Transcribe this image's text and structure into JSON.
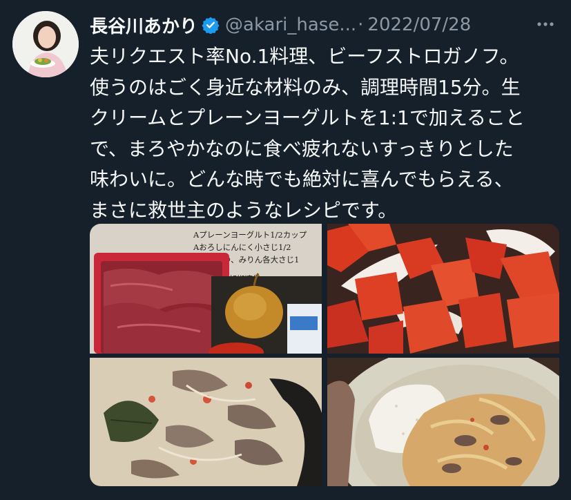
{
  "tweet": {
    "author_name": "長谷川あかり",
    "handle": "@akari_hase...",
    "separator": "·",
    "date": "2022/07/28",
    "verified": true,
    "text_lines": [
      "夫リクエスト率No.1料理、ビーフストロガノフ。",
      "使うのはごく身近な材料のみ、調理時間15分。生",
      "クリームとプレーンヨーグルトを1:1で加えること",
      "で、まろやかなのに食べ疲れないすっきりとした",
      "味わいに。どんな時でも絶対に喜んでもらえる、",
      "まさに救世主のようなレシピです。"
    ]
  },
  "media": {
    "photo1_text": [
      "Aプレーンヨーグルト1/2カップ",
      "Aおろしにんにく小さじ1/2",
      "Aしょうゆ、みりん各大さじ1",
      "塩胡椒適量"
    ]
  },
  "colors": {
    "background": "#15202b",
    "text": "#f7f9f9",
    "secondary": "#8b98a5",
    "verified": "#1d9bf0"
  },
  "icons": [
    "verified-badge-icon",
    "more-options-icon"
  ]
}
